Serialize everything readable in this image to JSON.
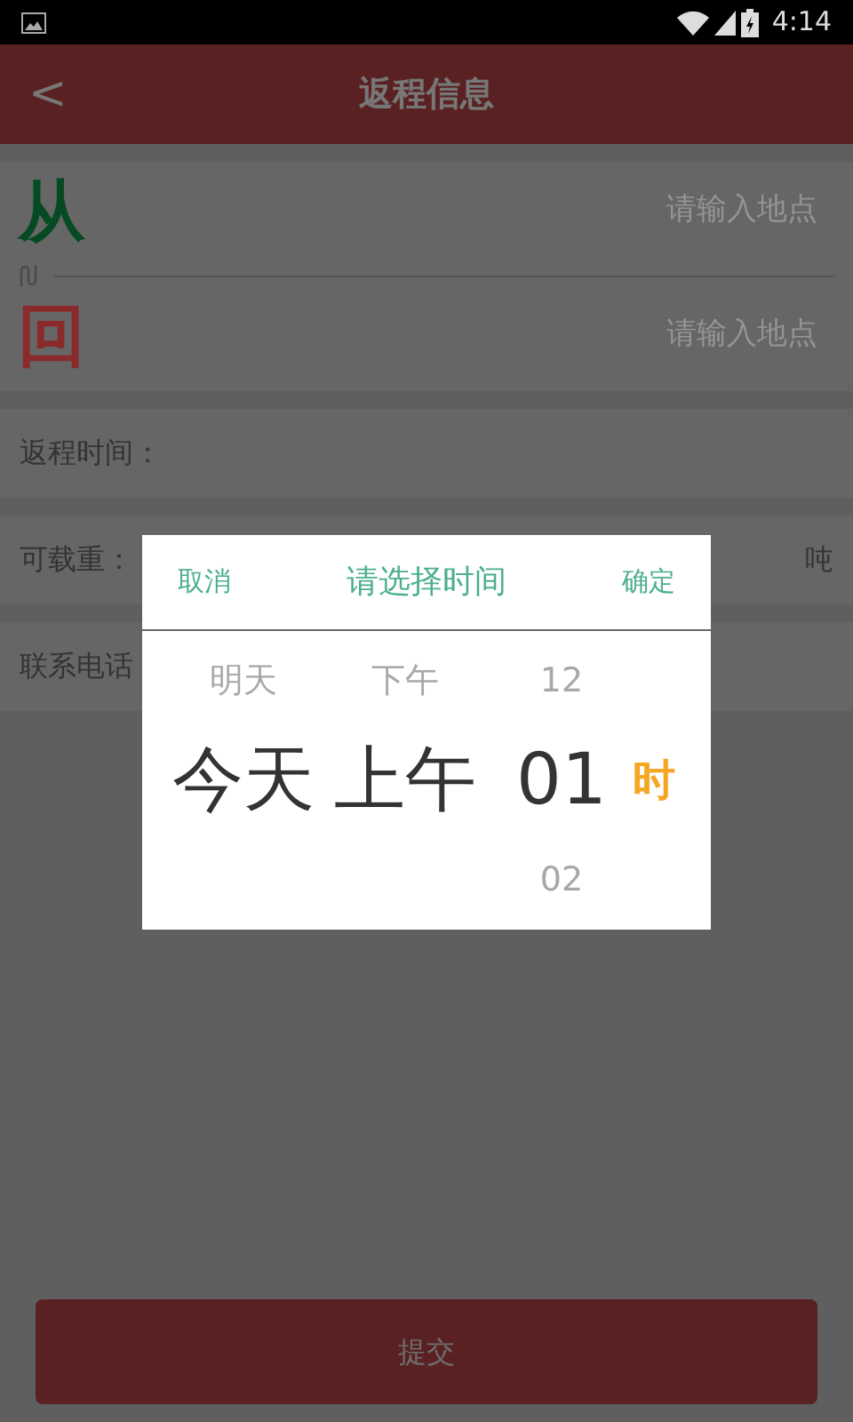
{
  "status_bar": {
    "time": "4:14"
  },
  "header": {
    "back": "<",
    "title": "返程信息"
  },
  "route": {
    "from": {
      "mark": "从",
      "placeholder": "请输入地点"
    },
    "to": {
      "mark": "回",
      "placeholder": "请输入地点"
    }
  },
  "fields": [
    {
      "label": "返程时间："
    },
    {
      "label": "可载重：",
      "unit": "吨"
    },
    {
      "label": "联系电话"
    }
  ],
  "dialog": {
    "cancel": "取消",
    "title": "请选择时间",
    "confirm": "确定",
    "unit": "时",
    "columns": [
      {
        "items": [
          {
            "label": "明天",
            "selected": false
          },
          {
            "label": "今天",
            "selected": true
          }
        ]
      },
      {
        "items": [
          {
            "label": "下午",
            "selected": false
          },
          {
            "label": "上午",
            "selected": true
          }
        ]
      },
      {
        "items": [
          {
            "label": "12",
            "selected": false
          },
          {
            "label": "01",
            "selected": true
          },
          {
            "label": "02",
            "selected": false
          }
        ]
      }
    ]
  },
  "submit": "提交"
}
